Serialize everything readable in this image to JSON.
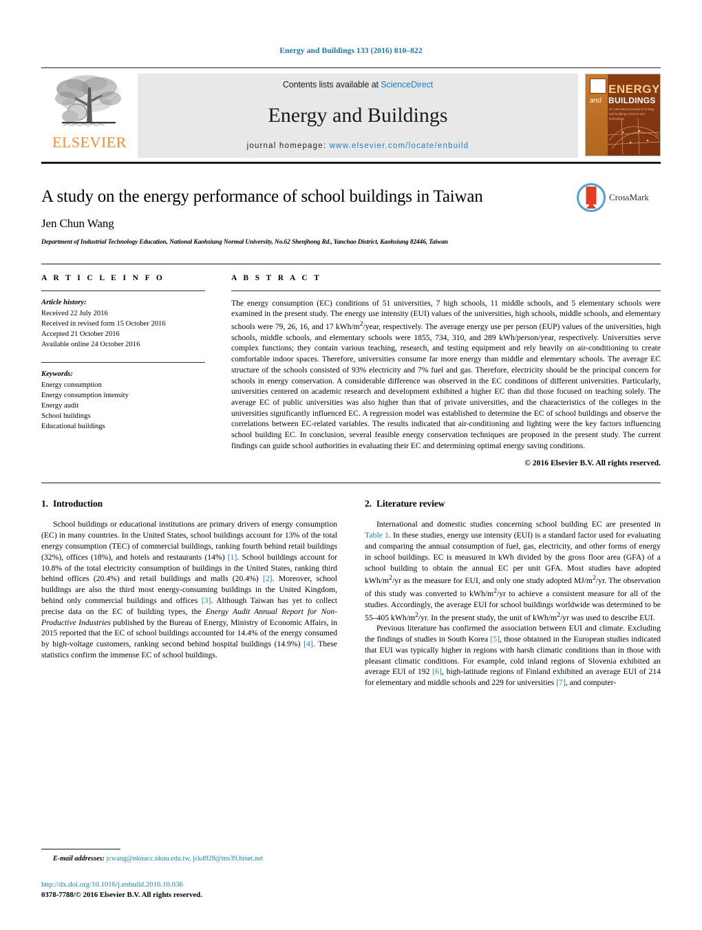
{
  "running_head": "Energy and Buildings 133 (2016) 810–822",
  "masthead": {
    "publisher_name": "ELSEVIER",
    "contents_prefix": "Contents lists available at ",
    "contents_link": "ScienceDirect",
    "journal_title": "Energy and Buildings",
    "homepage_prefix": "journal homepage: ",
    "homepage_url": "www.elsevier.com/locate/enbuild",
    "cover": {
      "and": "and",
      "energy": "ENERGY",
      "buildings": "BUILDINGS",
      "subtitle": "an international journal of energy and buildings science and technology"
    },
    "link_color": "#1a7fc1"
  },
  "article": {
    "title": "A study on the energy performance of school buildings in Taiwan",
    "authors": "Jen Chun Wang",
    "affiliation": "Department of Industrial Technology Education, National Kaohsiung Normal University, No.62 Shenjhong Rd., Yanchao District, Kaohsiung 82446, Taiwan",
    "crossmark_label": "CrossMark"
  },
  "article_info": {
    "heading": "A R T I C L E   I N F O",
    "history_label": "Article history:",
    "history": [
      "Received 22 July 2016",
      "Received in revised form 15 October 2016",
      "Accepted 21 October 2016",
      "Available online 24 October 2016"
    ],
    "keywords_label": "Keywords:",
    "keywords": [
      "Energy consumption",
      "Energy consumption intensity",
      "Energy audit",
      "School buildings",
      "Educational buildings"
    ]
  },
  "abstract": {
    "heading": "A B S T R A C T",
    "text": "The energy consumption (EC) conditions of 51 universities, 7 high schools, 11 middle schools, and 5 elementary schools were examined in the present study. The energy use intensity (EUI) values of the universities, high schools, middle schools, and elementary schools were 79, 26, 16, and 17 kWh/m2/year, respectively. The average energy use per person (EUP) values of the universities, high schools, middle schools, and elementary schools were 1855, 734, 310, and 289 kWh/person/year, respectively. Universities serve complex functions; they contain various teaching, research, and testing equipment and rely heavily on air-conditioning to create comfortable indoor spaces. Therefore, universities consume far more energy than middle and elementary schools. The average EC structure of the schools consisted of 93% electricity and 7% fuel and gas. Therefore, electricity should be the principal concern for schools in energy conservation. A considerable difference was observed in the EC conditions of different universities. Particularly, universities centered on academic research and development exhibited a higher EC than did those focused on teaching solely. The average EC of public universities was also higher than that of private universities, and the characteristics of the colleges in the universities significantly influenced EC. A regression model was established to determine the EC of school buildings and observe the correlations between EC-related variables. The results indicated that air-conditioning and lighting were the key factors influencing school building EC. In conclusion, several feasible energy conservation techniques are proposed in the present study. The current findings can guide school authorities in evaluating their EC and determining optimal energy saving conditions.",
    "copyright": "© 2016 Elsevier B.V. All rights reserved."
  },
  "sections": {
    "introduction": {
      "number": "1.",
      "title": "Introduction",
      "para1_a": "School buildings or educational institutions are primary drivers of energy consumption (EC) in many countries. In the United States, school buildings account for 13% of the total energy consumption (TEC) of commercial buildings, ranking fourth behind retail buildings (32%), offices (18%), and hotels and restaurants (14%) ",
      "ref1": "[1]",
      "para1_b": ". School buildings account for 10.8% of the total electricity consumption of buildings in the United States, ranking third behind offices (20.4%) and retail buildings and malls (20.4%) ",
      "ref2": "[2]",
      "para1_c": ". Moreover, school buildings are also the third most energy-consuming buildings in the United Kingdom, behind only commercial buildings and offices ",
      "ref3": "[3]",
      "para1_d": ". Although Taiwan has yet to collect precise data on the EC of building types, the ",
      "italic_title": "Energy Audit Annual Report for Non-Productive Industries",
      "para1_e": " published by the Bureau of Energy, Ministry of Economic Affairs, in 2015 reported that the EC of school buildings accounted for 14.4% of the energy consumed by high-voltage customers, ranking second behind hospital buildings (14.9%) ",
      "ref4": "[4]",
      "para1_f": ". These statistics confirm the immense EC of school buildings."
    },
    "literature": {
      "number": "2.",
      "title": "Literature review",
      "para1_a": "International and domestic studies concerning school building EC are presented in ",
      "table_ref": "Table 1",
      "para1_b": ". In these studies, energy use intensity (EUI) is a standard factor used for evaluating and comparing the annual consumption of fuel, gas, electricity, and other forms of energy in school buildings. EC is measured in kWh divided by the gross floor area (GFA) of a school building to obtain the annual EC per unit GFA. Most studies have adopted kWh/m2/yr as the measure for EUI, and only one study adopted MJ/m2/yr. The observation of this study was converted to kWh/m2/yr to achieve a consistent measure for all of the studies. Accordingly, the average EUI for school buildings worldwide was determined to be 55–405 kWh/m2/yr. In the present study, the unit of kWh/m2/yr was used to describe EUI.",
      "para2_a": "Previous literature has confirmed the association between EUI and climate. Excluding the findings of studies in South Korea ",
      "ref5": "[5]",
      "para2_b": ", those obtained in the European studies indicated that EUI was typically higher in regions with harsh climatic conditions than in those with pleasant climatic conditions. For example, cold inland regions of Slovenia exhibited an average EUI of 192 ",
      "ref6": "[6]",
      "para2_c": ", high-latitude regions of Finland exhibited an average EUI of 214 for elementary and middle schools and 229 for universities ",
      "ref7": "[7]",
      "para2_d": ", and computer-"
    }
  },
  "footer": {
    "email_label": "E-mail addresses:",
    "emails": " jcwang@nknucc.nknu.edu.tw, jck4928@ms39.hinet.net",
    "doi": "http://dx.doi.org/10.1016/j.enbuild.2016.10.036",
    "issn_line": "0378-7788/© 2016 Elsevier B.V. All rights reserved."
  }
}
